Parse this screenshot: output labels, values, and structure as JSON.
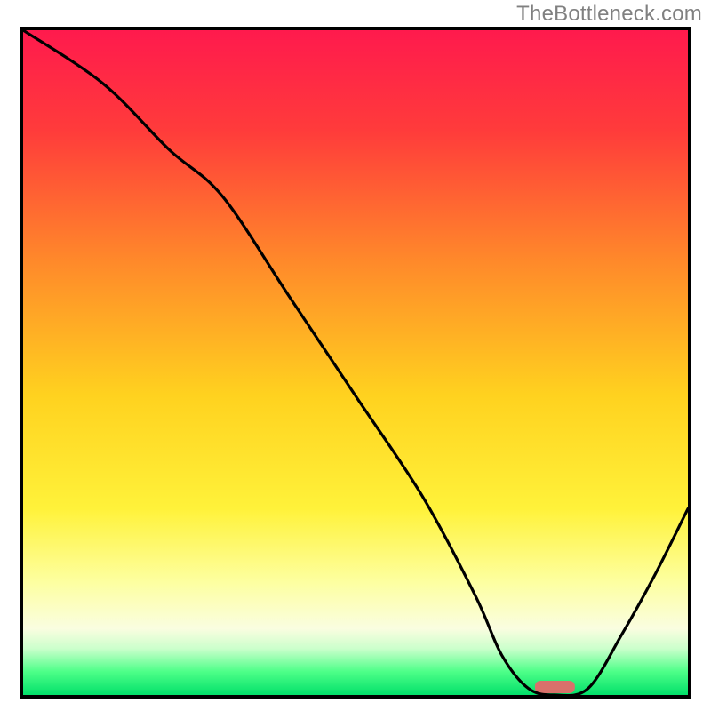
{
  "watermark": "TheBottleneck.com",
  "chart_data": {
    "type": "line",
    "title": "",
    "xlabel": "",
    "ylabel": "",
    "xlim": [
      0,
      100
    ],
    "ylim": [
      0,
      100
    ],
    "grid": false,
    "series": [
      {
        "name": "bottleneck-curve",
        "x": [
          0,
          12,
          22,
          30,
          40,
          50,
          60,
          68,
          72,
          76,
          80,
          85,
          90,
          95,
          100
        ],
        "values": [
          100,
          92,
          82,
          75,
          60,
          45,
          30,
          15,
          6,
          1,
          0,
          1,
          9,
          18,
          28
        ]
      }
    ],
    "marker": {
      "name": "optimal-range",
      "x_start": 77,
      "x_end": 83,
      "color": "#d9716b"
    },
    "background_gradient": {
      "type": "vertical-linear",
      "stops": [
        {
          "offset": 0.0,
          "color": "#ff1a4d"
        },
        {
          "offset": 0.15,
          "color": "#ff3b3b"
        },
        {
          "offset": 0.35,
          "color": "#ff8a2a"
        },
        {
          "offset": 0.55,
          "color": "#ffd21f"
        },
        {
          "offset": 0.72,
          "color": "#fff23a"
        },
        {
          "offset": 0.83,
          "color": "#fdffa0"
        },
        {
          "offset": 0.9,
          "color": "#fafde0"
        },
        {
          "offset": 0.93,
          "color": "#ccffcc"
        },
        {
          "offset": 0.965,
          "color": "#4dff88"
        },
        {
          "offset": 1.0,
          "color": "#02e06a"
        }
      ]
    }
  }
}
